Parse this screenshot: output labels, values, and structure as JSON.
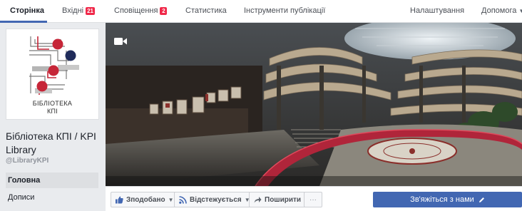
{
  "topnav": {
    "page_tab": "Сторінка",
    "inbox": "Вхідні",
    "inbox_count": "21",
    "notifications": "Сповіщення",
    "notifications_count": "2",
    "insights": "Статистика",
    "publishing_tools": "Інструменти публікації",
    "settings": "Налаштування",
    "help": "Допомога"
  },
  "profile": {
    "logo_text_line1": "БІБЛІОТЕКА",
    "logo_text_line2": "КПІ",
    "page_name": "Бібліотека КПІ / KPI Library",
    "handle": "@LibraryKPI"
  },
  "left_nav": {
    "items": [
      {
        "label": "Головна"
      },
      {
        "label": "Дописи"
      }
    ]
  },
  "actions": {
    "liked": "Зподобано",
    "following": "Відстежується",
    "share": "Поширити",
    "more": "···",
    "contact": "Зв'яжіться з нами"
  },
  "colors": {
    "brand_blue": "#4267b2",
    "badge_red": "#f02849",
    "logo_red": "#c62638",
    "logo_navy": "#1f2b5a"
  },
  "icons": [
    "video-camera-icon",
    "camera-icon",
    "like-thumb-icon",
    "rss-follow-icon",
    "share-arrow-icon",
    "pencil-icon",
    "chevron-down-icon"
  ]
}
